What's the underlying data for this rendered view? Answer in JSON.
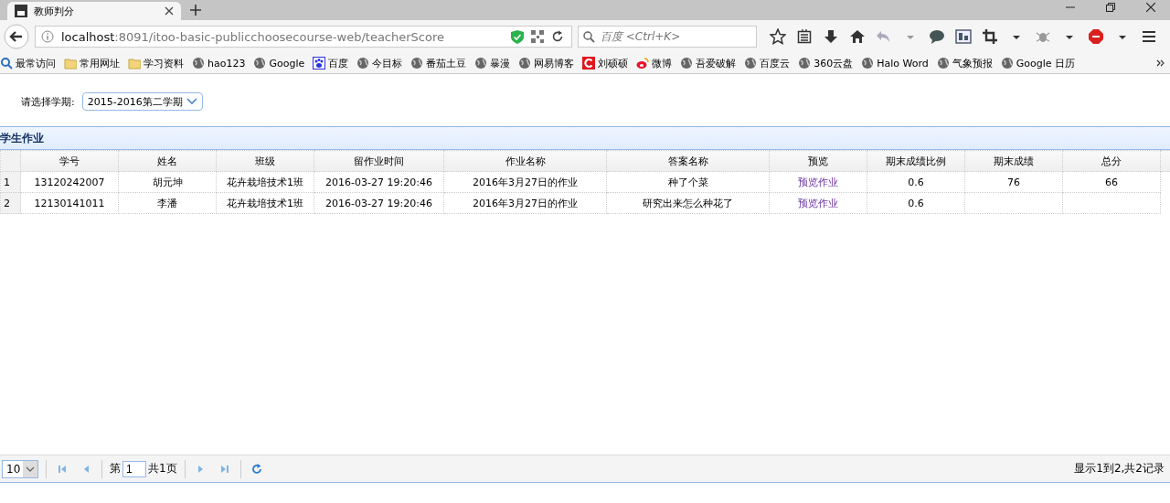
{
  "browser": {
    "tab": {
      "title": "教师判分",
      "selected": true
    },
    "address": {
      "host": "localhost",
      "path": ":8091/itoo-basic-publicchoosecourse-web/teacherScore"
    },
    "search": {
      "placeholder": "百度 <Ctrl+K>"
    },
    "bookmarks": [
      {
        "label": "最常访问",
        "kind": "recent"
      },
      {
        "label": "常用网址",
        "kind": "folder"
      },
      {
        "label": "学习资料",
        "kind": "folder"
      },
      {
        "label": "hao123",
        "kind": "globe"
      },
      {
        "label": "Google",
        "kind": "globe"
      },
      {
        "label": "百度",
        "kind": "paw"
      },
      {
        "label": "今目标",
        "kind": "globe"
      },
      {
        "label": "番茄土豆",
        "kind": "globe"
      },
      {
        "label": "暴漫",
        "kind": "globe"
      },
      {
        "label": "网易博客",
        "kind": "globe"
      },
      {
        "label": "刘硕硕",
        "kind": "redc"
      },
      {
        "label": "微博",
        "kind": "weibo"
      },
      {
        "label": "吾爱破解",
        "kind": "globe"
      },
      {
        "label": "百度云",
        "kind": "globe"
      },
      {
        "label": "360云盘",
        "kind": "globe"
      },
      {
        "label": "Halo Word",
        "kind": "globe"
      },
      {
        "label": "气象预报",
        "kind": "globe"
      },
      {
        "label": "Google 日历",
        "kind": "globe"
      }
    ]
  },
  "term": {
    "label": "请选择学期:",
    "value": "2015-2016第二学期"
  },
  "grid": {
    "title": "学生作业",
    "columns": [
      {
        "label": "学号",
        "kind": "text"
      },
      {
        "label": "姓名",
        "kind": "text"
      },
      {
        "label": "班级",
        "kind": "text"
      },
      {
        "label": "留作业时间",
        "kind": "text"
      },
      {
        "label": "作业名称",
        "kind": "text"
      },
      {
        "label": "答案名称",
        "kind": "text"
      },
      {
        "label": "预览",
        "kind": "link"
      },
      {
        "label": "期末成绩比例",
        "kind": "text"
      },
      {
        "label": "期末成绩",
        "kind": "text"
      },
      {
        "label": "总分",
        "kind": "text"
      }
    ],
    "rows": [
      {
        "number": "1",
        "cells": [
          "13120242007",
          "胡元坤",
          "花卉栽培技术1班",
          "2016-03-27 19:20:46",
          "2016年3月27日的作业",
          "种了个菜",
          "预览作业",
          "0.6",
          "76",
          "66"
        ]
      },
      {
        "number": "2",
        "cells": [
          "12130141011",
          "李潘",
          "花卉栽培技术1班",
          "2016-03-27 19:20:46",
          "2016年3月27日的作业",
          "研究出来怎么种花了",
          "预览作业",
          "0.6",
          "",
          ""
        ]
      }
    ]
  },
  "pager": {
    "page_size": "10",
    "page_prefix": "第",
    "page": "1",
    "page_total": "共1页",
    "summary": "显示1到2,共2记录"
  }
}
